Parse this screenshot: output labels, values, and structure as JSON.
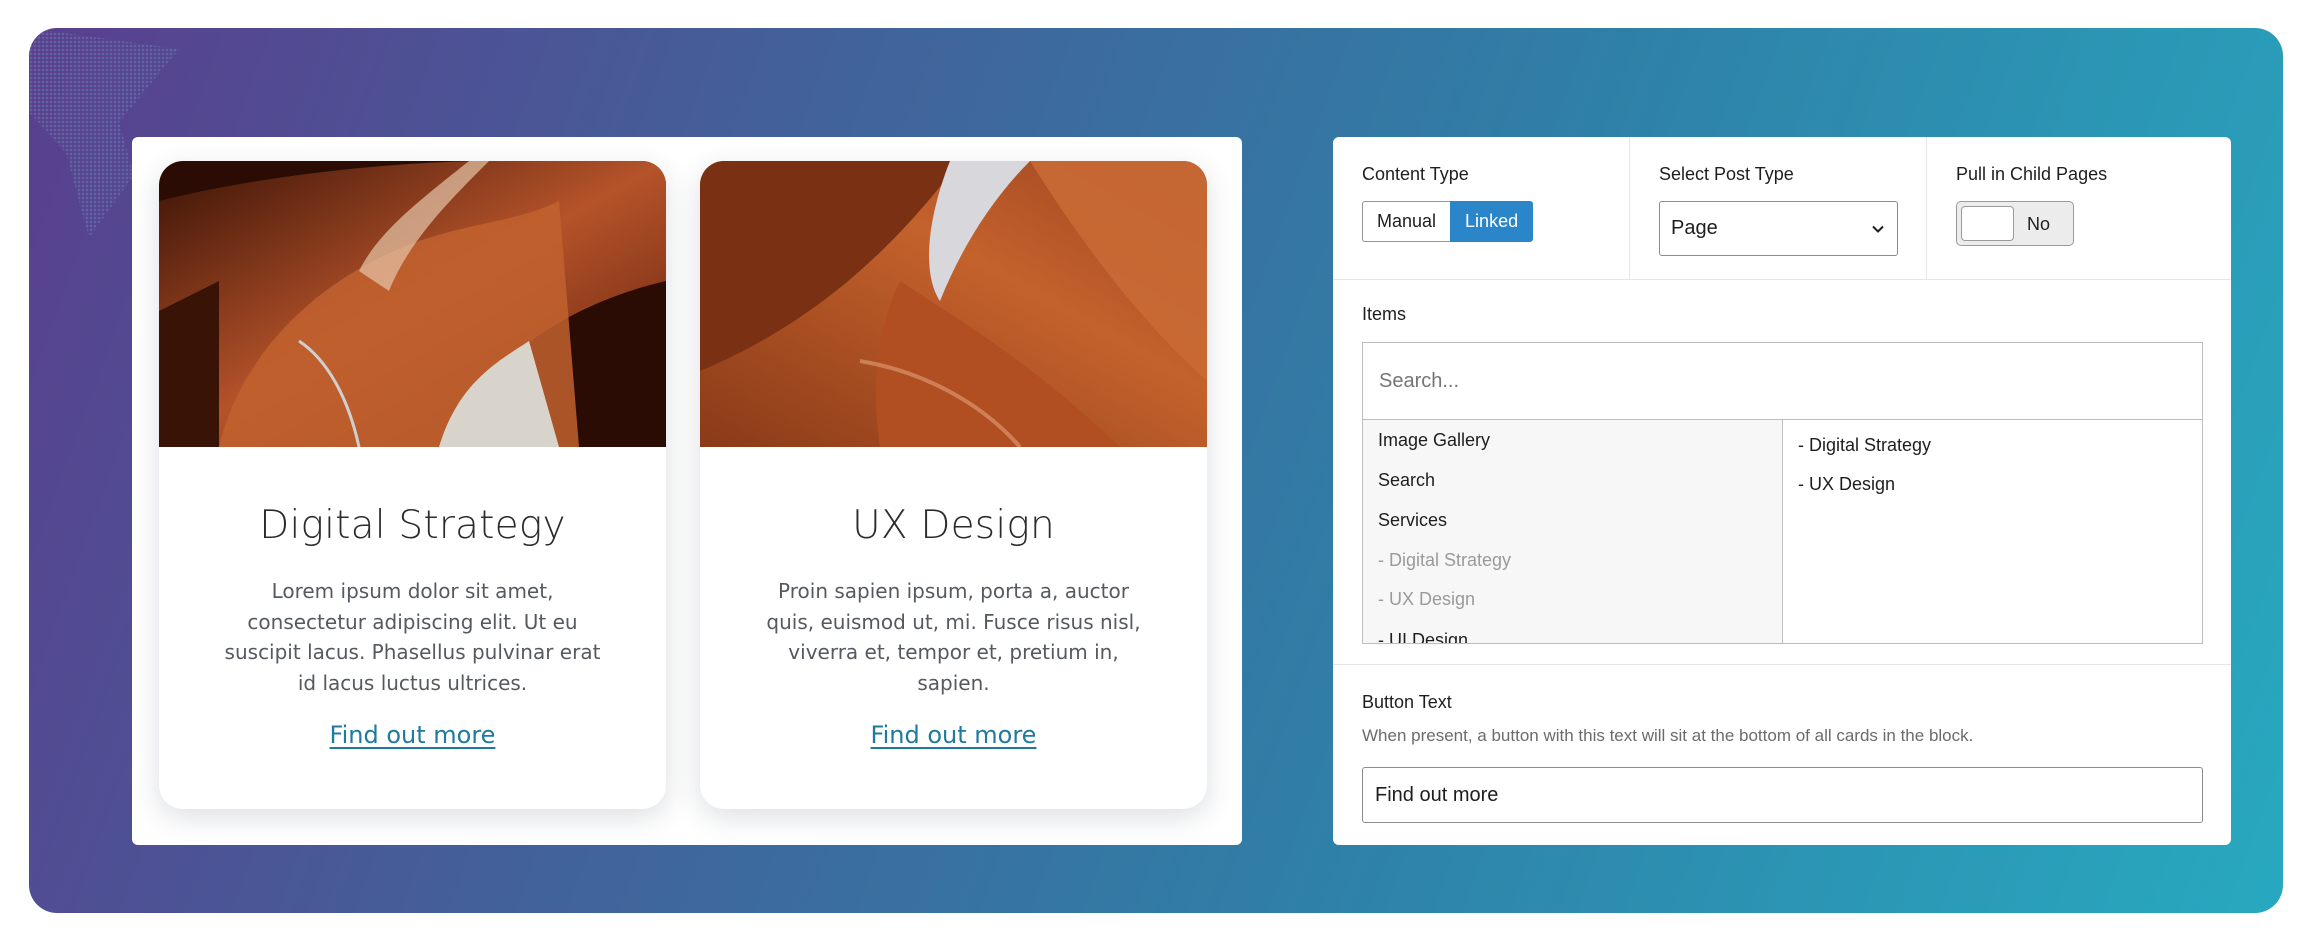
{
  "preview": {
    "cards": [
      {
        "title": "Digital Strategy",
        "body": "Lorem ipsum dolor sit amet, consectetur adipiscing elit. Ut eu suscipit lacus. Phasellus pulvinar erat id lacus luctus ultrices.",
        "link": "Find out more"
      },
      {
        "title": "UX Design",
        "body": "Proin sapien ipsum, porta a, auctor quis, euismod ut, mi. Fusce risus nisl, viverra et, tempor et, pretium in, sapien.",
        "link": "Find out more"
      }
    ]
  },
  "settings": {
    "content_type": {
      "label": "Content Type",
      "options": [
        "Manual",
        "Linked"
      ],
      "selected": "Linked"
    },
    "post_type": {
      "label": "Select Post Type",
      "value": "Page"
    },
    "child_pages": {
      "label": "Pull in Child Pages",
      "value": "No"
    },
    "items": {
      "label": "Items",
      "search_placeholder": "Search...",
      "available": [
        {
          "label": "Image Gallery",
          "disabled": false
        },
        {
          "label": "Search",
          "disabled": false
        },
        {
          "label": "Services",
          "disabled": false
        },
        {
          "label": "- Digital Strategy",
          "disabled": true
        },
        {
          "label": "- UX Design",
          "disabled": true
        },
        {
          "label": "- UI Design",
          "disabled": false
        }
      ],
      "selected": [
        "- Digital Strategy",
        "- UX Design"
      ]
    },
    "button_text": {
      "label": "Button Text",
      "help": "When present, a button with this text will sit at the bottom of all cards in the block.",
      "value": "Find out more"
    }
  },
  "colors": {
    "accent": "#2a86c9",
    "link": "#1f7a9e",
    "bg_gradient_start": "#5a3f8e",
    "bg_gradient_end": "#28a9c0",
    "image_tone": "#b5532a"
  }
}
